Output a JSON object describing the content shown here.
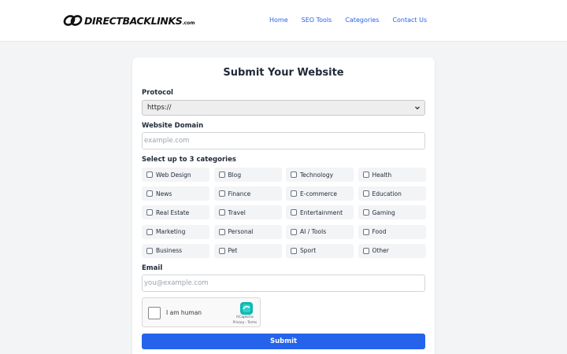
{
  "header": {
    "logo_text": "DIRECTBACKLINKS",
    "logo_suffix": ".com",
    "nav": [
      "Home",
      "SEO Tools",
      "Categories",
      "Contact Us"
    ]
  },
  "form": {
    "title": "Submit Your Website",
    "protocol_label": "Protocol",
    "protocol_value": "https://",
    "domain_label": "Website Domain",
    "domain_placeholder": "example.com",
    "categories_label": "Select up to 3 categories",
    "categories": [
      "Web Design",
      "Blog",
      "Technology",
      "Health",
      "News",
      "Finance",
      "E-commerce",
      "Education",
      "Real Estate",
      "Travel",
      "Entertainment",
      "Gaming",
      "Marketing",
      "Personal",
      "AI / Tools",
      "Food",
      "Business",
      "Pet",
      "Sport",
      "Other"
    ],
    "email_label": "Email",
    "email_placeholder": "you@example.com",
    "captcha_label": "I am human",
    "captcha_brand": "hCaptcha",
    "captcha_terms": "Privacy - Terms",
    "submit_label": "Submit"
  },
  "colors": {
    "accent": "#2563eb",
    "page_bg": "#f3f4f6",
    "captcha_teal": "#0fb7b2"
  }
}
